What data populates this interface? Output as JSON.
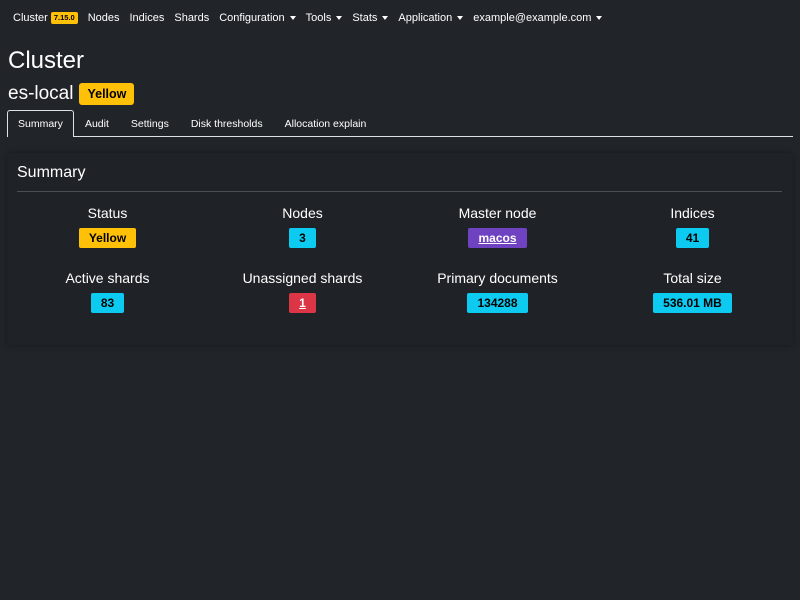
{
  "navbar": {
    "brand": "Cluster",
    "version": "7.15.0",
    "items": [
      {
        "label": "Nodes",
        "dropdown": false
      },
      {
        "label": "Indices",
        "dropdown": false
      },
      {
        "label": "Shards",
        "dropdown": false
      },
      {
        "label": "Configuration",
        "dropdown": true
      },
      {
        "label": "Tools",
        "dropdown": true
      },
      {
        "label": "Stats",
        "dropdown": true
      },
      {
        "label": "Application",
        "dropdown": true
      },
      {
        "label": "example@example.com",
        "dropdown": true
      }
    ]
  },
  "page": {
    "title": "Cluster",
    "cluster_name": "es-local",
    "health": "Yellow"
  },
  "tabs": [
    {
      "label": "Summary",
      "active": true
    },
    {
      "label": "Audit",
      "active": false
    },
    {
      "label": "Settings",
      "active": false
    },
    {
      "label": "Disk thresholds",
      "active": false
    },
    {
      "label": "Allocation explain",
      "active": false
    }
  ],
  "summary": {
    "title": "Summary",
    "stats": [
      {
        "label": "Status",
        "value": "Yellow",
        "color": "#ffc107",
        "link": false
      },
      {
        "label": "Nodes",
        "value": "3",
        "color": "#0dcaf0",
        "link": false
      },
      {
        "label": "Master node",
        "value": "macos",
        "color": "#6f42c1",
        "link": true
      },
      {
        "label": "Indices",
        "value": "41",
        "color": "#0dcaf0",
        "link": false
      },
      {
        "label": "Active shards",
        "value": "83",
        "color": "#0dcaf0",
        "link": false
      },
      {
        "label": "Unassigned shards",
        "value": "1",
        "color": "#dc3545",
        "link": true
      },
      {
        "label": "Primary documents",
        "value": "134288",
        "color": "#0dcaf0",
        "link": false
      },
      {
        "label": "Total size",
        "value": "536.01 MB",
        "color": "#0dcaf0",
        "link": false
      }
    ]
  },
  "colors": {
    "background": "#212529",
    "warning": "#ffc107",
    "info": "#0dcaf0",
    "danger": "#dc3545",
    "purple": "#6f42c1"
  }
}
